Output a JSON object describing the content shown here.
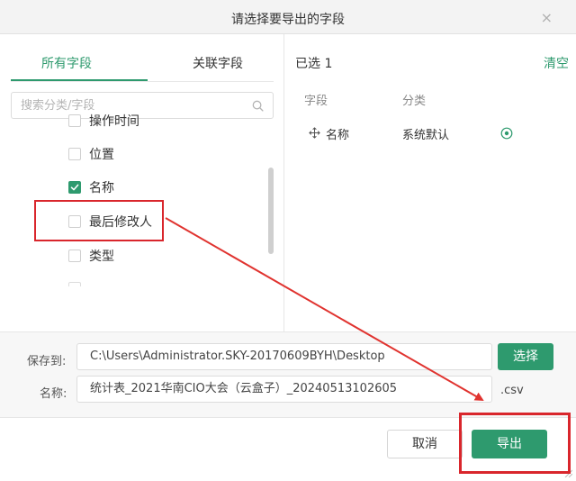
{
  "dialog": {
    "title": "请选择要导出的字段",
    "close_glyph": "×"
  },
  "tabs": {
    "all": "所有字段",
    "related": "关联字段"
  },
  "search": {
    "placeholder": "搜索分类/字段"
  },
  "fields": [
    {
      "label": "操作时间",
      "checked": false
    },
    {
      "label": "位置",
      "checked": false
    },
    {
      "label": "名称",
      "checked": true
    },
    {
      "label": "最后修改人",
      "checked": false
    },
    {
      "label": "类型",
      "checked": false
    }
  ],
  "selected": {
    "count_label": "已选 1",
    "clear_label": "清空",
    "col_field": "字段",
    "col_category": "分类",
    "rows": [
      {
        "name": "名称",
        "category": "系统默认"
      }
    ]
  },
  "save": {
    "save_to_label": "保存到:",
    "path": "C:\\Users\\Administrator.SKY-20170609BYH\\Desktop",
    "choose_label": "选择",
    "name_label": "名称:",
    "filename": "统计表_2021华南CIO大会（云盒子）_20240513102605",
    "extension": ".csv"
  },
  "footer": {
    "cancel_label": "取消",
    "export_label": "导出"
  },
  "colors": {
    "accent": "#2e9a6e",
    "annotation": "#d9262c"
  },
  "icons": {
    "search": "search-icon",
    "drag": "drag-handle-icon",
    "remove": "remove-circle-icon",
    "close": "close-icon",
    "check": "check-icon"
  }
}
